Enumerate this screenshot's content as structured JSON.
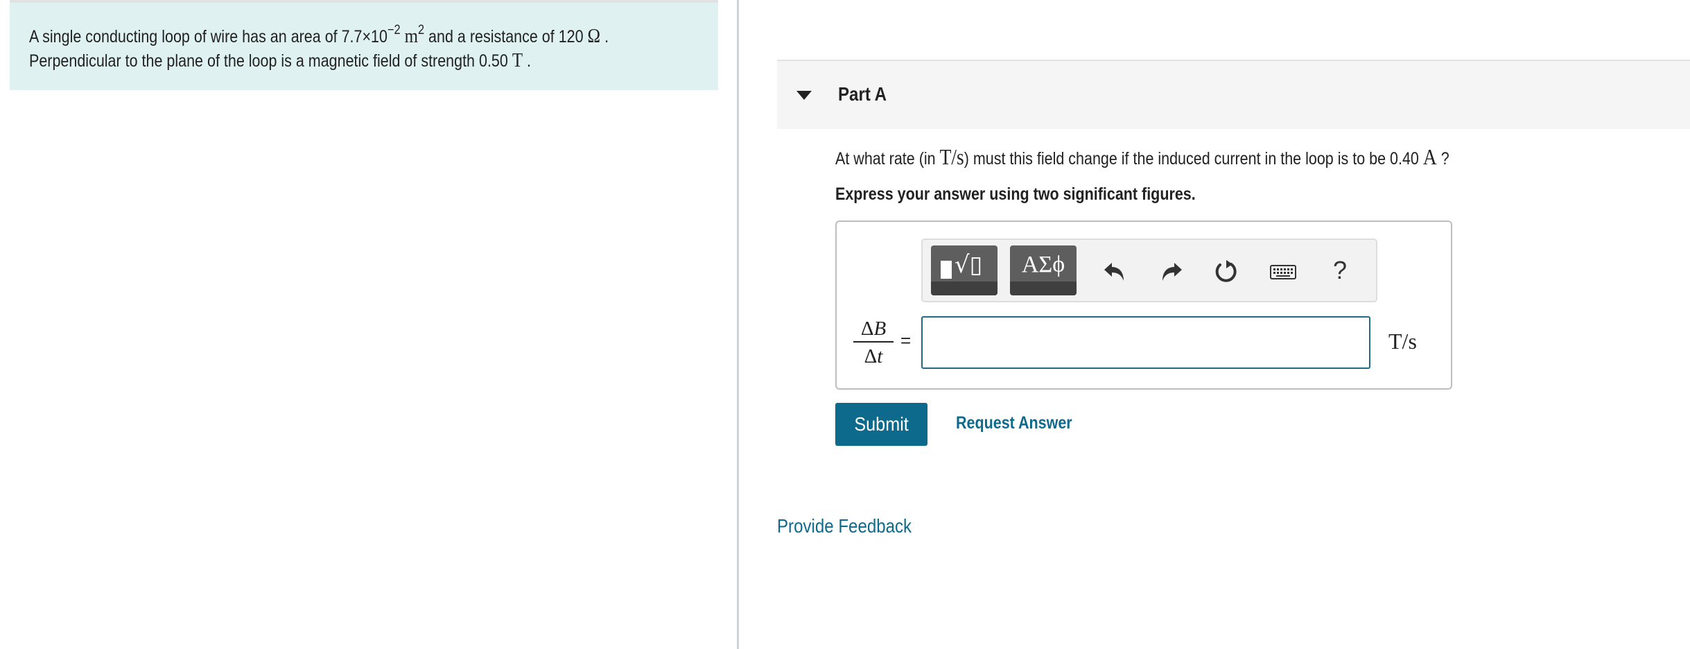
{
  "problem": {
    "line1": {
      "pre": "A single conducting loop of wire has an area of 7.7×10",
      "exponent": "−2",
      "unit_base": "m",
      "unit_exponent": "2",
      "mid": " and a resistance of 120 ",
      "resistance_unit": "Ω",
      "end": " ."
    },
    "line2": {
      "pre": "Perpendicular to the plane of the loop is a magnetic field of strength 0.50 ",
      "field_unit": "T",
      "end": " ."
    }
  },
  "part": {
    "title": "Part A",
    "question": {
      "pre": "At what rate (in ",
      "rate_unit": "T/s",
      "mid": ") must this field change if the induced current in the loop is to be 0.40 ",
      "current_unit": "A",
      "end": " ?"
    },
    "instructions": "Express your answer using two significant figures."
  },
  "answer": {
    "toolbar": {
      "symbols_label": "ΑΣϕ",
      "help_label": "?"
    },
    "variable": {
      "numerator": "ΔB",
      "denominator": "Δt"
    },
    "equals": "=",
    "input_value": "",
    "unit": "T/s"
  },
  "actions": {
    "submit_label": "Submit",
    "request_answer_label": "Request Answer",
    "feedback_label": "Provide Feedback"
  },
  "colors": {
    "accent": "#0e6a8c",
    "intro_background": "#dff1f1",
    "header_background": "#f5f5f5"
  },
  "icons": [
    "templates-icon",
    "undo-icon",
    "redo-icon",
    "reset-icon",
    "keyboard-icon",
    "help-icon",
    "collapse-triangle-icon"
  ]
}
